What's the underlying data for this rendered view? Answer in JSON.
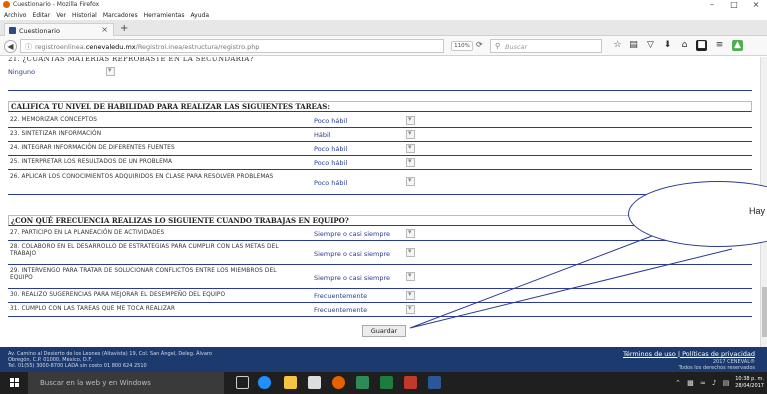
{
  "window": {
    "title": "Cuestionario - Mozilla Firefox",
    "minimize": "–",
    "maximize": "□",
    "close": "×"
  },
  "menu": [
    "Archivo",
    "Editar",
    "Ver",
    "Historial",
    "Marcadores",
    "Herramientas",
    "Ayuda"
  ],
  "tab": {
    "label": "Cuestionario",
    "close": "×",
    "new_tab": "+"
  },
  "nav": {
    "url_prefix": "registroenlinea.",
    "url_domain": "cenevaledu.mx",
    "url_path": "/Registroi.inea/estructura/registro.php",
    "zoom": "110%",
    "search_placeholder": "Buscar"
  },
  "form": {
    "cut_heading": "21. ¿CUÁNTAS MATERIAS REPROBASTE EN LA SECUNDARIA?",
    "ninguno": "Ninguno",
    "section1_title": "CALIFICA TU NIVEL DE HABILIDAD PARA REALIZAR LAS SIGUIENTES TAREAS:",
    "section1_rows": [
      {
        "q": "22. MEMORIZAR CONCEPTOS",
        "a": "Poco hábil"
      },
      {
        "q": "23. SINTETIZAR INFORMACIÓN",
        "a": "Hábil"
      },
      {
        "q": "24. INTEGRAR INFORMACIÓN DE DIFERENTES FUENTES",
        "a": "Poco hábil"
      },
      {
        "q": "25. INTERPRETAR LOS RESULTADOS DE UN PROBLEMA",
        "a": "Poco hábil"
      },
      {
        "q": "26. APLICAR LOS CONOCIMIENTOS ADQUIRIDOS EN CLASE PARA RESOLVER PROBLEMAS",
        "a": "Poco hábil"
      }
    ],
    "section2_title": "¿CON QUÉ FRECUENCIA REALIZAS LO SIGUIENTE CUANDO TRABAJAS EN EQUIPO?",
    "section2_rows": [
      {
        "q": "27. PARTICIPO EN LA PLANEACIÓN DE ACTIVIDADES",
        "a": "Siempre o casi siempre"
      },
      {
        "q": "28. COLABORO EN EL DESARROLLO DE ESTRATEGIAS PARA CUMPLIR CON LAS METAS DEL TRABAJO",
        "a": "Siempre o casi siempre"
      },
      {
        "q": "29. INTERVENGO PARA TRATAR DE SOLUCIONAR CONFLICTOS ENTRE LOS MIEMBROS DEL EQUIPO",
        "a": "Siempre o casi siempre"
      },
      {
        "q": "30. REALIZO SUGERENCIAS PARA MEJORAR EL DESEMPEÑO DEL EQUIPO",
        "a": "Frecuentemente"
      },
      {
        "q": "31. CUMPLO CON LAS TAREAS QUE ME TOCA REALIZAR",
        "a": "Frecuentemente"
      }
    ],
    "submit": "Guardar"
  },
  "callout": {
    "text": "Hay"
  },
  "footer": {
    "addr1": "Av. Camino al Desierto de los Leones (Altavista) 19, Col. San Ángel, Deleg. Álvaro",
    "addr2": "Obregón, C.P. 01000, México, D.F.",
    "addr3": "Tel. 01(55) 3000-8700 LADA sin costo 01 800 624 2510",
    "links": "Términos de uso | Políticas de privacidad",
    "copy1": "2017 CENEVAL®",
    "copy2": "Todos los derechos reservados"
  },
  "taskbar": {
    "search": "Buscar en la web y en Windows",
    "time": "10:38 p. m.",
    "date": "28/04/2017"
  },
  "colors": {
    "accent": "#2a3a96",
    "footer": "#1d3a6e",
    "taskbar": "#1f1f1f"
  }
}
